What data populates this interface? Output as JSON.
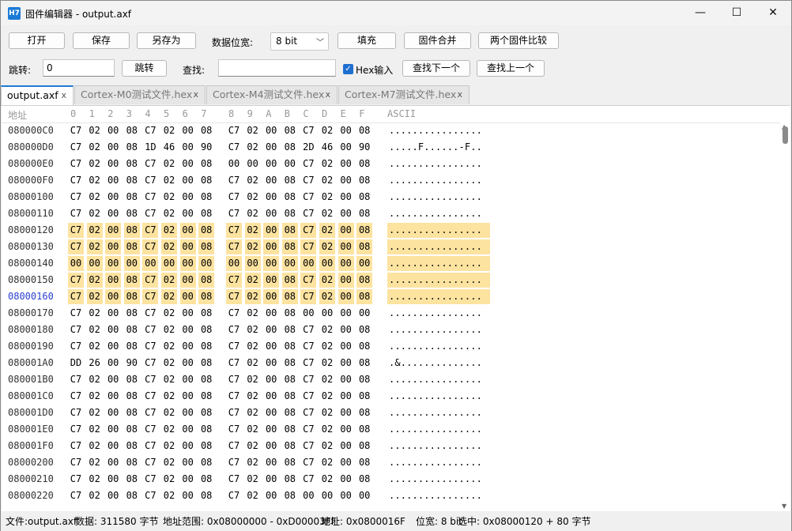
{
  "titlebar": {
    "icon_text": "H7",
    "title": "固件编辑器 - output.axf",
    "min": "—",
    "max": "☐",
    "close": "✕"
  },
  "toolbar": {
    "open": "打开",
    "save": "保存",
    "save_as": "另存为",
    "bitwidth_label": "数据位宽:",
    "bitwidth_value": "8 bit",
    "fill": "填充",
    "merge": "固件合并",
    "compare": "两个固件比较",
    "goto_label": "跳转:",
    "goto_value": "0",
    "goto_button": "跳转",
    "find_label": "查找:",
    "find_value": "",
    "hex_input_label": "Hex输入",
    "hex_input_checked": true,
    "find_next": "查找下一个",
    "find_prev": "查找上一个"
  },
  "tabs": [
    {
      "label": "output.axf",
      "active": true
    },
    {
      "label": "Cortex-M0测试文件.hex",
      "active": false
    },
    {
      "label": "Cortex-M4测试文件.hex",
      "active": false
    },
    {
      "label": "Cortex-M7测试文件.hex",
      "active": false
    }
  ],
  "tab_close": "x",
  "hex_view": {
    "address_header": "地址",
    "column_headers": [
      "0",
      "1",
      "2",
      "3",
      "4",
      "5",
      "6",
      "7",
      "8",
      "9",
      "A",
      "B",
      "C",
      "D",
      "E",
      "F"
    ],
    "ascii_header": "ASCII",
    "highlight_color": "#fde3a0",
    "current_address_color": "#2a3ed0",
    "rows": [
      {
        "addr": "080000C0",
        "bytes": [
          "C7",
          "02",
          "00",
          "08",
          "C7",
          "02",
          "00",
          "08",
          "C7",
          "02",
          "00",
          "08",
          "C7",
          "02",
          "00",
          "08"
        ],
        "ascii": "................",
        "hl": false,
        "cur": false
      },
      {
        "addr": "080000D0",
        "bytes": [
          "C7",
          "02",
          "00",
          "08",
          "1D",
          "46",
          "00",
          "90",
          "C7",
          "02",
          "00",
          "08",
          "2D",
          "46",
          "00",
          "90"
        ],
        "ascii": ".....F......-F..",
        "hl": false,
        "cur": false
      },
      {
        "addr": "080000E0",
        "bytes": [
          "C7",
          "02",
          "00",
          "08",
          "C7",
          "02",
          "00",
          "08",
          "00",
          "00",
          "00",
          "00",
          "C7",
          "02",
          "00",
          "08"
        ],
        "ascii": "................",
        "hl": false,
        "cur": false
      },
      {
        "addr": "080000F0",
        "bytes": [
          "C7",
          "02",
          "00",
          "08",
          "C7",
          "02",
          "00",
          "08",
          "C7",
          "02",
          "00",
          "08",
          "C7",
          "02",
          "00",
          "08"
        ],
        "ascii": "................",
        "hl": false,
        "cur": false
      },
      {
        "addr": "08000100",
        "bytes": [
          "C7",
          "02",
          "00",
          "08",
          "C7",
          "02",
          "00",
          "08",
          "C7",
          "02",
          "00",
          "08",
          "C7",
          "02",
          "00",
          "08"
        ],
        "ascii": "................",
        "hl": false,
        "cur": false
      },
      {
        "addr": "08000110",
        "bytes": [
          "C7",
          "02",
          "00",
          "08",
          "C7",
          "02",
          "00",
          "08",
          "C7",
          "02",
          "00",
          "08",
          "C7",
          "02",
          "00",
          "08"
        ],
        "ascii": "................",
        "hl": false,
        "cur": false
      },
      {
        "addr": "08000120",
        "bytes": [
          "C7",
          "02",
          "00",
          "08",
          "C7",
          "02",
          "00",
          "08",
          "C7",
          "02",
          "00",
          "08",
          "C7",
          "02",
          "00",
          "08"
        ],
        "ascii": "................",
        "hl": true,
        "cur": false
      },
      {
        "addr": "08000130",
        "bytes": [
          "C7",
          "02",
          "00",
          "08",
          "C7",
          "02",
          "00",
          "08",
          "C7",
          "02",
          "00",
          "08",
          "C7",
          "02",
          "00",
          "08"
        ],
        "ascii": "................",
        "hl": true,
        "cur": false
      },
      {
        "addr": "08000140",
        "bytes": [
          "00",
          "00",
          "00",
          "00",
          "00",
          "00",
          "00",
          "00",
          "00",
          "00",
          "00",
          "00",
          "00",
          "00",
          "00",
          "00"
        ],
        "ascii": "................",
        "hl": true,
        "cur": false
      },
      {
        "addr": "08000150",
        "bytes": [
          "C7",
          "02",
          "00",
          "08",
          "C7",
          "02",
          "00",
          "08",
          "C7",
          "02",
          "00",
          "08",
          "C7",
          "02",
          "00",
          "08"
        ],
        "ascii": "................",
        "hl": true,
        "cur": false
      },
      {
        "addr": "08000160",
        "bytes": [
          "C7",
          "02",
          "00",
          "08",
          "C7",
          "02",
          "00",
          "08",
          "C7",
          "02",
          "00",
          "08",
          "C7",
          "02",
          "00",
          "08"
        ],
        "ascii": "................",
        "hl": true,
        "cur": true
      },
      {
        "addr": "08000170",
        "bytes": [
          "C7",
          "02",
          "00",
          "08",
          "C7",
          "02",
          "00",
          "08",
          "C7",
          "02",
          "00",
          "08",
          "00",
          "00",
          "00",
          "00"
        ],
        "ascii": "................",
        "hl": false,
        "cur": false
      },
      {
        "addr": "08000180",
        "bytes": [
          "C7",
          "02",
          "00",
          "08",
          "C7",
          "02",
          "00",
          "08",
          "C7",
          "02",
          "00",
          "08",
          "C7",
          "02",
          "00",
          "08"
        ],
        "ascii": "................",
        "hl": false,
        "cur": false
      },
      {
        "addr": "08000190",
        "bytes": [
          "C7",
          "02",
          "00",
          "08",
          "C7",
          "02",
          "00",
          "08",
          "C7",
          "02",
          "00",
          "08",
          "C7",
          "02",
          "00",
          "08"
        ],
        "ascii": "................",
        "hl": false,
        "cur": false
      },
      {
        "addr": "080001A0",
        "bytes": [
          "DD",
          "26",
          "00",
          "90",
          "C7",
          "02",
          "00",
          "08",
          "C7",
          "02",
          "00",
          "08",
          "C7",
          "02",
          "00",
          "08"
        ],
        "ascii": ".&..............",
        "hl": false,
        "cur": false
      },
      {
        "addr": "080001B0",
        "bytes": [
          "C7",
          "02",
          "00",
          "08",
          "C7",
          "02",
          "00",
          "08",
          "C7",
          "02",
          "00",
          "08",
          "C7",
          "02",
          "00",
          "08"
        ],
        "ascii": "................",
        "hl": false,
        "cur": false
      },
      {
        "addr": "080001C0",
        "bytes": [
          "C7",
          "02",
          "00",
          "08",
          "C7",
          "02",
          "00",
          "08",
          "C7",
          "02",
          "00",
          "08",
          "C7",
          "02",
          "00",
          "08"
        ],
        "ascii": "................",
        "hl": false,
        "cur": false
      },
      {
        "addr": "080001D0",
        "bytes": [
          "C7",
          "02",
          "00",
          "08",
          "C7",
          "02",
          "00",
          "08",
          "C7",
          "02",
          "00",
          "08",
          "C7",
          "02",
          "00",
          "08"
        ],
        "ascii": "................",
        "hl": false,
        "cur": false
      },
      {
        "addr": "080001E0",
        "bytes": [
          "C7",
          "02",
          "00",
          "08",
          "C7",
          "02",
          "00",
          "08",
          "C7",
          "02",
          "00",
          "08",
          "C7",
          "02",
          "00",
          "08"
        ],
        "ascii": "................",
        "hl": false,
        "cur": false
      },
      {
        "addr": "080001F0",
        "bytes": [
          "C7",
          "02",
          "00",
          "08",
          "C7",
          "02",
          "00",
          "08",
          "C7",
          "02",
          "00",
          "08",
          "C7",
          "02",
          "00",
          "08"
        ],
        "ascii": "................",
        "hl": false,
        "cur": false
      },
      {
        "addr": "08000200",
        "bytes": [
          "C7",
          "02",
          "00",
          "08",
          "C7",
          "02",
          "00",
          "08",
          "C7",
          "02",
          "00",
          "08",
          "C7",
          "02",
          "00",
          "08"
        ],
        "ascii": "................",
        "hl": false,
        "cur": false
      },
      {
        "addr": "08000210",
        "bytes": [
          "C7",
          "02",
          "00",
          "08",
          "C7",
          "02",
          "00",
          "08",
          "C7",
          "02",
          "00",
          "08",
          "C7",
          "02",
          "00",
          "08"
        ],
        "ascii": "................",
        "hl": false,
        "cur": false
      },
      {
        "addr": "08000220",
        "bytes": [
          "C7",
          "02",
          "00",
          "08",
          "C7",
          "02",
          "00",
          "08",
          "C7",
          "02",
          "00",
          "08",
          "00",
          "00",
          "00",
          "00"
        ],
        "ascii": "................",
        "hl": false,
        "cur": false
      }
    ]
  },
  "scrollbar": {
    "up": "▲",
    "down": "▼"
  },
  "statusbar": {
    "file": "文件:output.axf",
    "size": "数据: 311580 字节",
    "range": "地址范围: 0x08000000 - 0xD00003FF",
    "address": "地址: 0x0800016F",
    "bitwidth": "位宽: 8 bit",
    "selection": "选中: 0x08000120 + 80 字节"
  }
}
